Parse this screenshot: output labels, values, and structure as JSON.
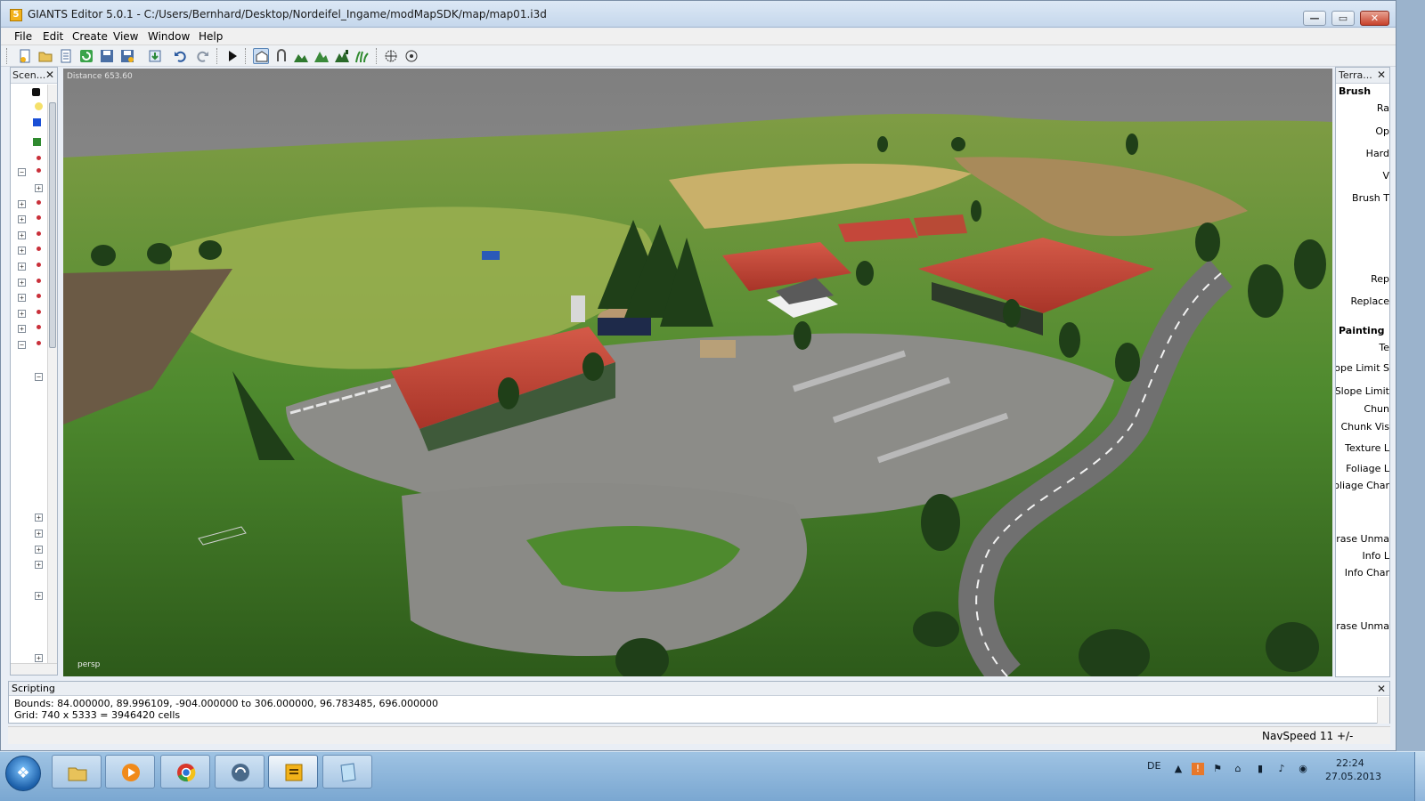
{
  "window": {
    "title": "GIANTS Editor 5.0.1 - C:/Users/Bernhard/Desktop/Nordeifel_Ingame/modMapSDK/map/map01.i3d",
    "minimize": "—",
    "maximize": "▭",
    "close": "✕",
    "app_icon": "5"
  },
  "menu": {
    "file": "File",
    "edit": "Edit",
    "create": "Create",
    "view": "View",
    "window": "Window",
    "help": "Help"
  },
  "scene_panel": {
    "title": "Scen...",
    "close": "✕"
  },
  "viewport": {
    "distance": "Distance 653.60",
    "camera": "persp"
  },
  "terrain_panel": {
    "title": "Terra...",
    "close": "✕",
    "brush_heading": "Brush",
    "brush_labels": [
      "Ra",
      "Op",
      "Hard",
      "V",
      "Brush T",
      "Rep",
      "Replace"
    ],
    "painting_heading": "Painting",
    "painting_labels": [
      "Te",
      "Slope Limit S",
      "Slope Limit",
      "Chun",
      "Chunk Vis",
      "Texture L",
      "Foliage L",
      "Foliage Char"
    ],
    "erase_labels": [
      "Erase Unma",
      "Info L",
      "Info Char",
      "Erase Unma"
    ]
  },
  "scripting": {
    "title": "Scripting",
    "close": "✕",
    "lines": [
      "Bounds: 84.000000, 89.996109, -904.000000 to 306.000000, 96.783485, 696.000000",
      "Grid: 740 x 5333 = 3946420 cells"
    ]
  },
  "status": {
    "nav_speed": "NavSpeed 11 +/-"
  },
  "taskbar": {
    "start": "❖",
    "apps": [
      "explorer-icon",
      "media-player-icon",
      "chrome-icon",
      "teamspeak-icon",
      "giants-editor-icon",
      "notepad-icon"
    ],
    "language": "DE",
    "time": "22:24",
    "date": "27.05.2013"
  },
  "colors": {
    "grass": "#4e8a2e",
    "field": "#c9b06a",
    "roof": "#c4473a",
    "road": "#707070",
    "sky": "#8e8e8e"
  }
}
